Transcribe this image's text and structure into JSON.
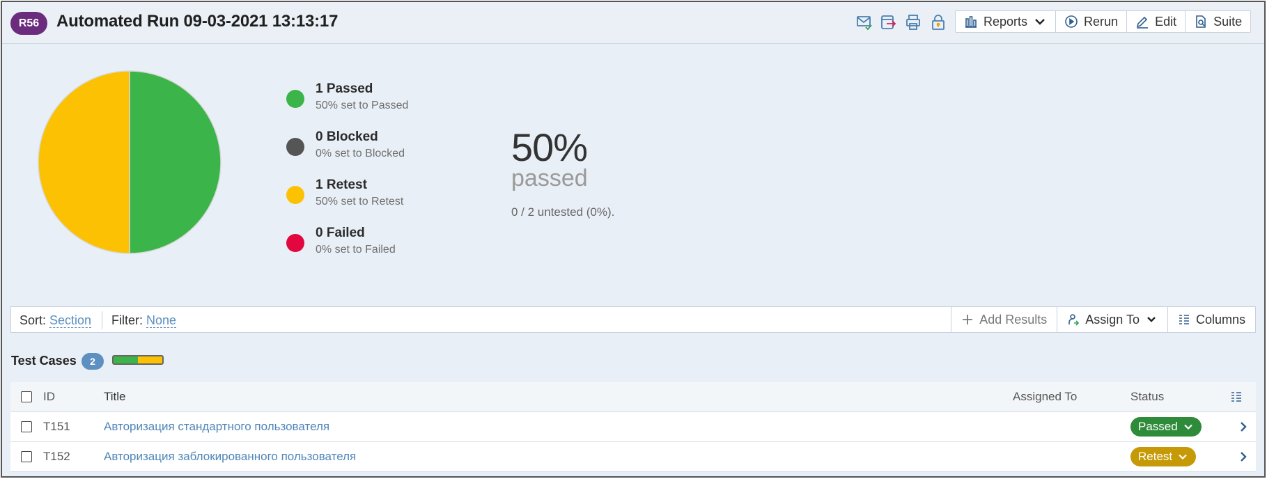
{
  "header": {
    "badge": "R56",
    "title": "Automated Run 09-03-2021 13:13:17",
    "icons": [
      "email-check-icon",
      "export-icon",
      "print-icon",
      "lock-icon"
    ],
    "buttons": {
      "reports": "Reports",
      "rerun": "Rerun",
      "edit": "Edit",
      "suite": "Suite"
    }
  },
  "summary": {
    "legend": [
      {
        "label": "1 Passed",
        "sub": "50% set to Passed",
        "color": "#3bb54a"
      },
      {
        "label": "0 Blocked",
        "sub": "0% set to Blocked",
        "color": "#555555"
      },
      {
        "label": "1 Retest",
        "sub": "50% set to Retest",
        "color": "#fbc102"
      },
      {
        "label": "0 Failed",
        "sub": "0% set to Failed",
        "color": "#e3073f"
      }
    ],
    "percent": "50%",
    "percent_word": "passed",
    "untested": "0 / 2 untested (0%)."
  },
  "chart_data": {
    "type": "pie",
    "categories": [
      "Passed",
      "Blocked",
      "Retest",
      "Failed"
    ],
    "values": [
      1,
      0,
      1,
      0
    ],
    "colors": [
      "#3bb54a",
      "#555555",
      "#fbc102",
      "#e3073f"
    ]
  },
  "filterbar": {
    "sort_label": "Sort:",
    "sort_value": "Section",
    "filter_label": "Filter:",
    "filter_value": "None",
    "add_results": "Add Results",
    "assign_to": "Assign To",
    "columns": "Columns"
  },
  "test_cases": {
    "title": "Test Cases",
    "count": "2",
    "progress": {
      "passed_fraction": 0.5,
      "retest_fraction": 0.5
    },
    "columns": {
      "id": "ID",
      "title": "Title",
      "assigned_to": "Assigned To",
      "status": "Status"
    },
    "rows": [
      {
        "id": "T151",
        "title": "Авторизация стандартного пользователя",
        "status": "Passed",
        "status_color": "#2e8b3a"
      },
      {
        "id": "T152",
        "title": "Авторизация заблокированного пользователя",
        "status": "Retest",
        "status_color": "#c59a06"
      }
    ]
  }
}
